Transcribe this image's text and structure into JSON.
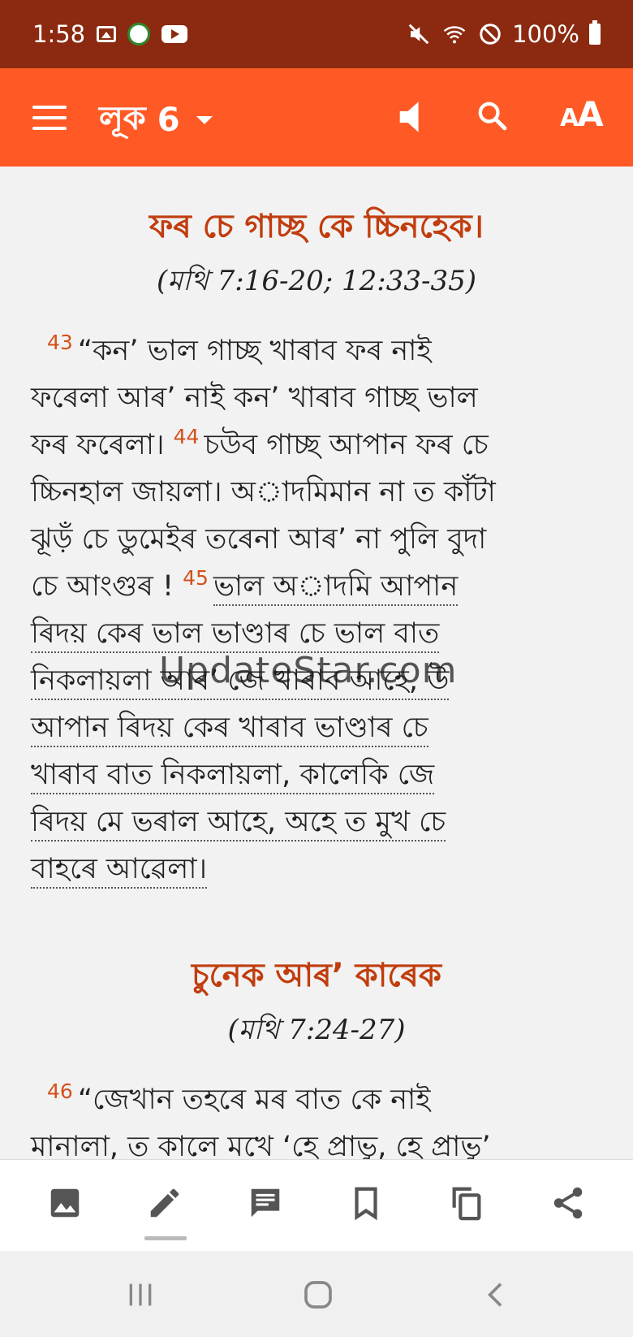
{
  "status_bar": {
    "time": "1:58",
    "battery_text": "100%",
    "left_icons": [
      "gallery-icon",
      "app-badge-icon",
      "youtube-icon"
    ],
    "right_icons": [
      "mute-icon",
      "wifi-icon",
      "do-not-disturb-icon",
      "battery-icon"
    ]
  },
  "app_bar": {
    "book": "লূক",
    "chapter": "6",
    "font_label_small": "A",
    "font_label_large": "A"
  },
  "sections": [
    {
      "heading": "ফৰ চে গাচ্ছ কে চ্চিনহেক।",
      "reference": "(মথি 7:16-20; 12:33-35)",
      "lines": [
        {
          "verse": "43",
          "text": "“কন’ ভাল গাচ্ছ খাৰাব ফৰ নাই"
        },
        {
          "text": "ফৰেলা আৰ’ নাই কন’ খাৰাব গাচ্ছ ভাল"
        },
        {
          "text": "ফৰ ফৰেলা।",
          "verse_after": "44",
          "text_after": "চউব গাচ্ছ আপান ফৰ চে"
        },
        {
          "text": "চ্চিনহাল জায়লা। অাদমিমান না ত কাঁটা"
        },
        {
          "text": "ঝূড়ঁ চে ডুমেইৰ তৰেনা আৰ’ না পুলি বুদা"
        },
        {
          "text": "চে আংগুৰ !",
          "verse_after": "45",
          "text_after": "ভাল অাদমি আপান",
          "dotted_after": true
        },
        {
          "text": "ৰিদয় কেৰ ভাল ভাণ্ডাৰ চে ভাল বাত",
          "dotted": true
        },
        {
          "text": "নিকলায়লা আৰ’ জে খাৰাব আহে, উ",
          "dotted": true
        },
        {
          "text": "আপান ৰিদয় কেৰ খাৰাব ভাণ্ডাৰ চে",
          "dotted": true
        },
        {
          "text": "খাৰাব বাত নিকলায়লা, কালেকি জে",
          "dotted": true
        },
        {
          "text": "ৰিদয় মে ভৰাল আহে, অহে ত মুখ চে",
          "dotted": true
        },
        {
          "text": "বাহৰে আৱেলা।",
          "dotted": true
        }
      ]
    },
    {
      "heading": "চুনেক আৰ’ কাৰেক",
      "reference": "(মথি 7:24-27)",
      "lines": [
        {
          "verse": "46",
          "text": "“জেখান তহৰে মৰ বাত কে নাই"
        },
        {
          "text": "মানালা, ত কালে মখে ‘হে প্ৰাভু, হে প্ৰাভু’"
        }
      ]
    }
  ],
  "watermark": "UpdateStar.com",
  "toolbar": [
    "image-icon",
    "highlight-pen-icon",
    "note-icon",
    "bookmark-icon",
    "copy-icon",
    "share-icon"
  ],
  "nav": [
    "recent-apps-icon",
    "home-icon",
    "back-icon"
  ],
  "colors": {
    "status_bar": "#8b2a10",
    "app_bar": "#ff5a26",
    "heading": "#c13d0e",
    "verse_number": "#d4501c"
  }
}
